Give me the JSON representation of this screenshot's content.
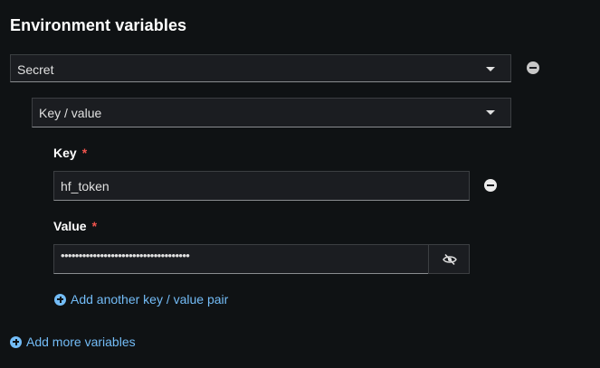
{
  "section": {
    "title": "Environment variables"
  },
  "env_type_select": {
    "value": "Secret",
    "icon": "chevron-down-icon"
  },
  "secret_type_select": {
    "value": "Key / value",
    "icon": "chevron-down-icon"
  },
  "key_field": {
    "label": "Key",
    "required_marker": "*",
    "value": "hf_token"
  },
  "value_field": {
    "label": "Value",
    "required_marker": "*",
    "masked_value": "••••••••••••••••••••••••••••••••••••",
    "toggle_icon": "eye-slash-icon"
  },
  "add_pair_link": {
    "label": "Add another key / value pair",
    "icon": "plus-circle-icon"
  },
  "add_variables_link": {
    "label": "Add more variables",
    "icon": "plus-circle-icon"
  },
  "remove_icon": "minus-circle-icon",
  "colors": {
    "background": "#0f1214",
    "input_bg": "#1b1d21",
    "link": "#73bcf7",
    "required": "#f0544d"
  }
}
